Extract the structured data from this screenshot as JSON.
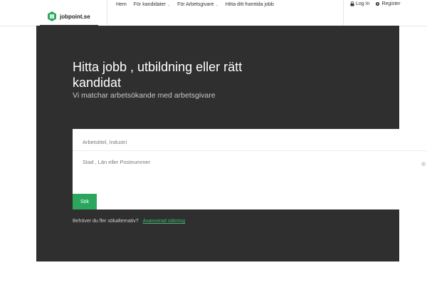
{
  "header": {
    "logo_text": "jobpoint.se",
    "nav": [
      {
        "label": "Hem",
        "caret": false
      },
      {
        "label": "För kandidater",
        "caret": true
      },
      {
        "label": "För Arbetsgivare",
        "caret": true
      },
      {
        "label": "Hitta ditt framtida jobb",
        "caret": false
      }
    ],
    "login_label": "Log In",
    "register_label": "Register"
  },
  "hero": {
    "title": "Hitta jobb , utbildning eller rätt kandidat",
    "subtitle": "Vi matchar arbetsökande med arbetsgivare"
  },
  "search": {
    "keyword_placeholder": "Arbetstitel, Industri",
    "location_placeholder": "Stad , Län eller Postnummer",
    "button_label": "Sök"
  },
  "help": {
    "text": "Behöver du fler sökalternativ?",
    "link_label": "Avancerad sökning"
  },
  "colors": {
    "hero_bg": "#2f2f2f",
    "accent": "#2aa75d",
    "logo_green": "#2aa75d"
  }
}
